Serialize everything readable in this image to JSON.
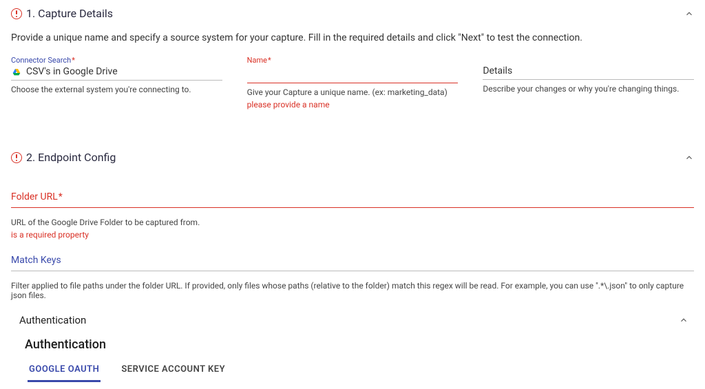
{
  "section1": {
    "title": "1. Capture Details",
    "intro": "Provide a unique name and specify a source system for your capture. Fill in the required details and click \"Next\" to test the connection.",
    "connector": {
      "label": "Connector Search",
      "value": "CSV's in Google Drive",
      "help": "Choose the external system you're connecting to."
    },
    "name": {
      "label": "Name",
      "help": "Give your Capture a unique name. (ex: marketing_data)",
      "error": "please provide a name"
    },
    "details": {
      "label": "Details",
      "help": "Describe your changes or why you're changing things."
    }
  },
  "section2": {
    "title": "2. Endpoint Config",
    "folder": {
      "label": "Folder URL",
      "help": "URL of the Google Drive Folder to be captured from.",
      "error": "is a required property"
    },
    "match": {
      "label": "Match Keys",
      "help": "Filter applied to file paths under the folder URL. If provided, only files whose paths (relative to the folder) match this regex will be read. For example, you can use \".*\\.json\" to only capture json files."
    },
    "auth": {
      "header": "Authentication",
      "title": "Authentication",
      "tabs": {
        "oauth": "GOOGLE OAUTH",
        "service": "SERVICE ACCOUNT KEY"
      }
    }
  },
  "asterisk": "*"
}
